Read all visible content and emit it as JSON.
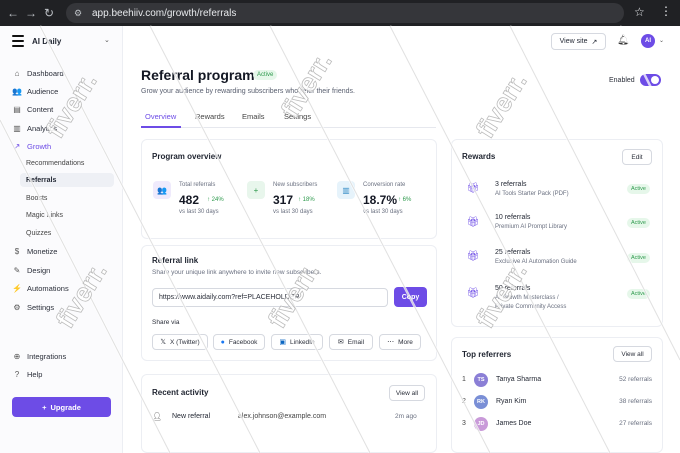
{
  "browser": {
    "url": "app.beehiiv.com/growth/referrals"
  },
  "sidebar": {
    "workspace": "AI Daily",
    "items": [
      {
        "label": "Dashboard",
        "icon": "home-icon"
      },
      {
        "label": "Audience",
        "icon": "users-icon"
      },
      {
        "label": "Content",
        "icon": "document-icon"
      },
      {
        "label": "Analytics",
        "icon": "chart-icon"
      },
      {
        "label": "Growth",
        "icon": "growth-icon"
      },
      {
        "label": "Monetize",
        "icon": "dollar-icon"
      },
      {
        "label": "Design",
        "icon": "brush-icon"
      },
      {
        "label": "Automations",
        "icon": "bolt-icon"
      },
      {
        "label": "Settings",
        "icon": "gear-icon"
      }
    ],
    "growth_sub": [
      "Recommendations",
      "Referrals",
      "Boosts",
      "Magic Links",
      "Quizzes"
    ],
    "bottom_items": [
      "Integrations",
      "Help"
    ],
    "upgrade_label": "Upgrade"
  },
  "topbar": {
    "view_site": "View site",
    "avatar_initials": "AI"
  },
  "header": {
    "title": "Referral program",
    "status": "Active",
    "subtitle": "Grow your audience by rewarding subscribers who refer their friends.",
    "enabled_label": "Enabled",
    "enabled": true
  },
  "tabs": [
    "Overview",
    "Rewards",
    "Emails",
    "Settings"
  ],
  "overview": {
    "title": "Program overview",
    "stats": [
      {
        "label": "Total referrals",
        "value": "482",
        "change": "↑ 24%",
        "sub": "vs last 30 days"
      },
      {
        "label": "New subscribers",
        "value": "317",
        "change": "↑ 18%",
        "sub": "vs last 30 days"
      },
      {
        "label": "Conversion rate",
        "value": "18.7%",
        "change": "↑ 6%",
        "sub": "vs last 30 days"
      }
    ]
  },
  "referral_link": {
    "title": "Referral link",
    "description": "Share your unique link anywhere to invite new subscribers.",
    "value": "https://www.aidaily.com?ref=PLACEHOLDER",
    "copy_label": "Copy",
    "share_via": "Share via",
    "share_buttons": [
      "X (Twitter)",
      "Facebook",
      "LinkedIn",
      "Email",
      "More"
    ]
  },
  "rewards": {
    "title": "Rewards",
    "edit_label": "Edit",
    "items": [
      {
        "threshold": "3 referrals",
        "desc1": "AI Tools Starter Pack (PDF)",
        "desc2": "",
        "status": "Active"
      },
      {
        "threshold": "10 referrals",
        "desc1": "Premium AI Prompt Library",
        "desc2": "",
        "status": "Active"
      },
      {
        "threshold": "25 referrals",
        "desc1": "Exclusive AI Automation Guide",
        "desc2": "",
        "status": "Active"
      },
      {
        "threshold": "50 referrals",
        "desc1": "AI Growth Masterclass /",
        "desc2": "Private Community Access",
        "status": "Active"
      }
    ]
  },
  "top_referrers": {
    "title": "Top referrers",
    "view_all": "View all",
    "items": [
      {
        "rank": "1",
        "initials": "TS",
        "name": "Tanya Sharma",
        "count": "52 referrals",
        "color": "#8b7fd6"
      },
      {
        "rank": "2",
        "initials": "RK",
        "name": "Ryan Kim",
        "count": "38 referrals",
        "color": "#7a8fd6"
      },
      {
        "rank": "3",
        "initials": "JD",
        "name": "James Doe",
        "count": "27 referrals",
        "color": "#c99ad9"
      }
    ]
  },
  "recent_activity": {
    "title": "Recent activity",
    "view_all": "View all",
    "items": [
      {
        "label": "New referral",
        "email": "alex.johnson@example.com",
        "time": "2m ago"
      }
    ]
  },
  "watermark": "fiverr.",
  "colors": {
    "accent": "#6d4ce6",
    "success": "#2e9a4d",
    "success_bg": "#e6f7ea"
  }
}
